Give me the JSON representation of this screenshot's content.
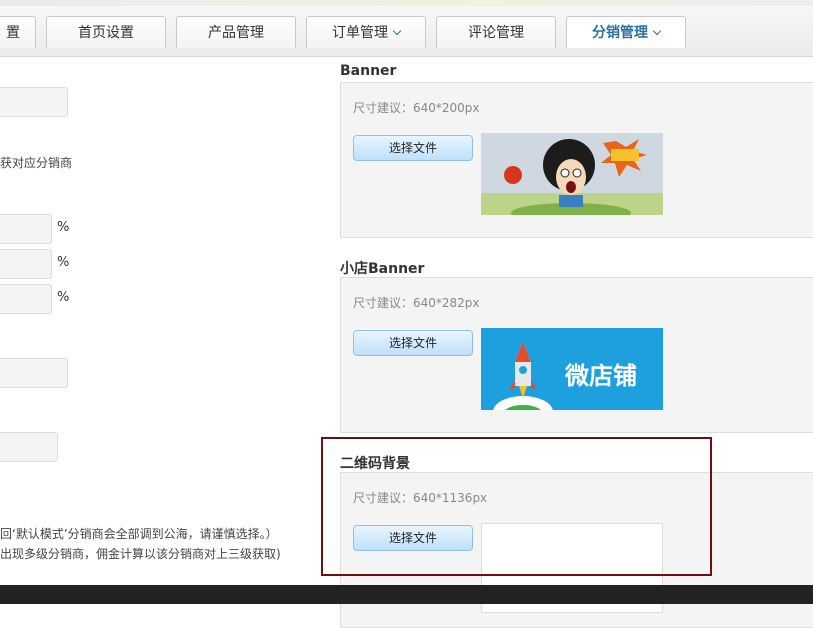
{
  "tabs": [
    {
      "label": "置",
      "active": false,
      "dropdown": false
    },
    {
      "label": "首页设置",
      "active": false,
      "dropdown": false
    },
    {
      "label": "产品管理",
      "active": false,
      "dropdown": false
    },
    {
      "label": "订单管理",
      "active": false,
      "dropdown": true
    },
    {
      "label": "评论管理",
      "active": false,
      "dropdown": false
    },
    {
      "label": "分销管理",
      "active": true,
      "dropdown": true
    }
  ],
  "left": {
    "note_top": "获对应分销商",
    "percent_sign": "%",
    "note_bottom_1": "回‘默认模式’分销商会全部调到公海，请谨慎选择。）",
    "note_bottom_2": "出现多级分销商，佣金计算以该分销商对上三级获取)"
  },
  "sections": [
    {
      "title": "Banner",
      "hint": "尺寸建议：640*200px",
      "button": "选择文件",
      "image": "banner-cartoon-thumbnail"
    },
    {
      "title": "小店Banner",
      "hint": "尺寸建议：640*282px",
      "button": "选择文件",
      "image": "shop-banner-thumbnail",
      "image_text": "微店铺"
    },
    {
      "title": "二维码背景",
      "hint": "尺寸建议：640*1136px",
      "button": "选择文件",
      "image": "empty-thumbnail"
    }
  ],
  "colors": {
    "accent": "#2f6f9c",
    "highlight": "#6e1010",
    "panel": "#f4f4f4",
    "shop_banner_bg": "#1fa0de"
  }
}
